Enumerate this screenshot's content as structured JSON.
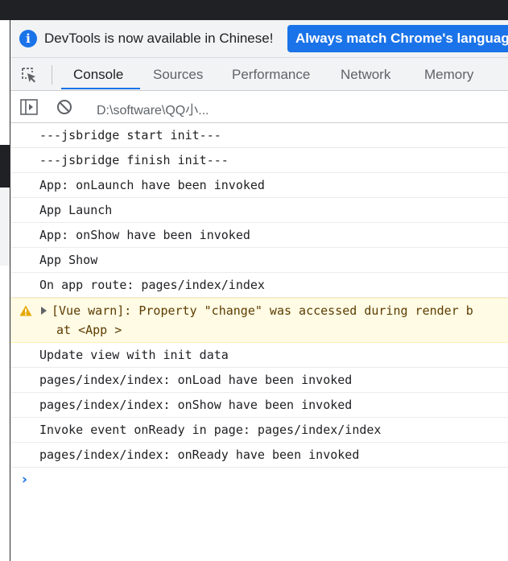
{
  "infobar": {
    "message": "DevTools is now available in Chinese!",
    "match_button": "Always match Chrome's language"
  },
  "tabs": [
    {
      "label": "Console",
      "active": true
    },
    {
      "label": "Sources"
    },
    {
      "label": "Performance"
    },
    {
      "label": "Network"
    },
    {
      "label": "Memory"
    }
  ],
  "toolbar": {
    "context": "D:\\software\\QQ小..."
  },
  "console": {
    "logs": [
      "---jsbridge start init---",
      "---jsbridge finish init---",
      "App: onLaunch have been invoked",
      "App Launch",
      "App: onShow have been invoked",
      "App Show",
      "On app route: pages/index/index"
    ],
    "warning": {
      "line1": "[Vue warn]: Property \"change\" was accessed during render b",
      "line2": "at <App >"
    },
    "logs_after": [
      "Update view with init data",
      "pages/index/index: onLoad have been invoked",
      "pages/index/index: onShow have been invoked",
      "Invoke event onReady in page: pages/index/index",
      "pages/index/index: onReady have been invoked"
    ],
    "prompt_symbol": "›"
  },
  "colors": {
    "accent": "#1a73e8",
    "warning_bg": "#fffbe5",
    "warning_icon": "#e6a700"
  }
}
